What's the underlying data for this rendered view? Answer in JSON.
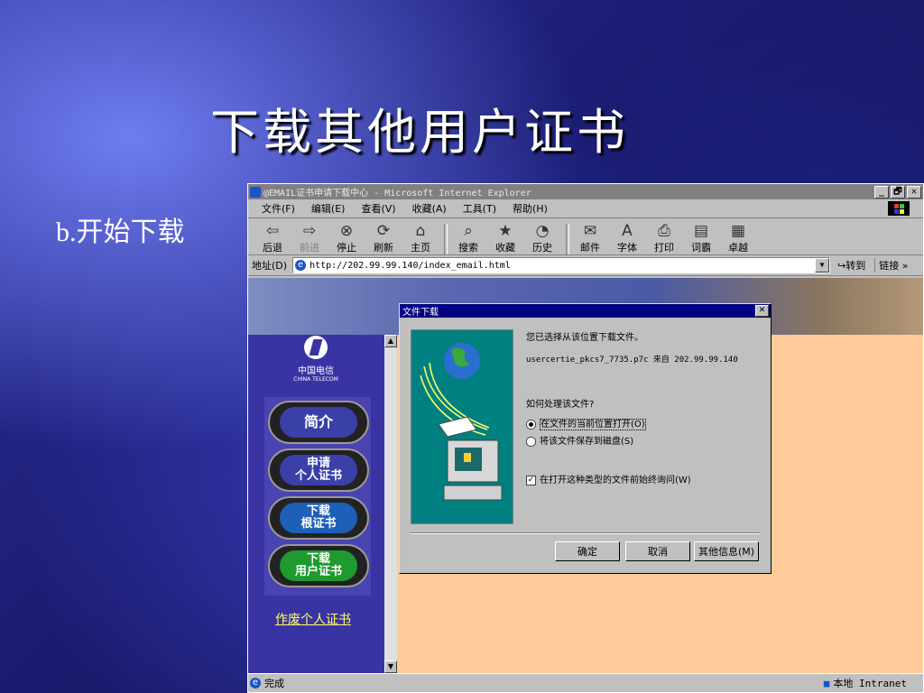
{
  "slide": {
    "title": "下载其他用户证书",
    "bullet": "b.开始下载"
  },
  "window": {
    "title": "@EMAIL证书申请下载中心 - Microsoft Internet Explorer",
    "controls": {
      "minimize": "_",
      "maximize": "🗗",
      "close": "✕"
    }
  },
  "menu": {
    "items": [
      "文件(F)",
      "编辑(E)",
      "查看(V)",
      "收藏(A)",
      "工具(T)",
      "帮助(H)"
    ]
  },
  "toolbar": {
    "buttons": [
      {
        "label": "后退",
        "icon": "back-icon",
        "glyph": "⇦"
      },
      {
        "label": "前进",
        "icon": "forward-icon",
        "glyph": "⇨"
      },
      {
        "label": "停止",
        "icon": "stop-icon",
        "glyph": "⊗"
      },
      {
        "label": "刷新",
        "icon": "refresh-icon",
        "glyph": "⟳"
      },
      {
        "label": "主页",
        "icon": "home-icon",
        "glyph": "⌂"
      },
      {
        "label": "搜索",
        "icon": "search-icon",
        "glyph": "⌕"
      },
      {
        "label": "收藏",
        "icon": "favorites-icon",
        "glyph": "★"
      },
      {
        "label": "历史",
        "icon": "history-icon",
        "glyph": "◔"
      },
      {
        "label": "邮件",
        "icon": "mail-icon",
        "glyph": "✉"
      },
      {
        "label": "字体",
        "icon": "font-icon",
        "glyph": "A"
      },
      {
        "label": "打印",
        "icon": "print-icon",
        "glyph": "⎙"
      },
      {
        "label": "词霸",
        "icon": "dictionary-icon",
        "glyph": "▤"
      },
      {
        "label": "卓越",
        "icon": "joyo-icon",
        "glyph": "▦"
      }
    ]
  },
  "address": {
    "label": "地址(D)",
    "url": "http://202.99.99.140/index_email.html",
    "go": "转到",
    "links": "链接 »"
  },
  "sidebar": {
    "logo_cn": "中国电信",
    "logo_en": "CHINA TELECOM",
    "nav": [
      {
        "label": "简介",
        "color": "#3b3fa8"
      },
      {
        "label": "申请\n个人证书",
        "color": "#3b3fa8"
      },
      {
        "label": "下载\n根证书",
        "color": "#1e5fb8"
      },
      {
        "label": "下载\n用户证书",
        "color": "#1e9a2e"
      }
    ],
    "revoke_link": "作废个人证书"
  },
  "status": {
    "text": "完成",
    "zone": "本地 Intranet"
  },
  "dialog": {
    "title": "文件下载",
    "close": "✕",
    "intro": "您已选择从该位置下载文件。",
    "file_line": "usercertie_pkcs7_7735.p7c 来自 202.99.99.140",
    "question": "如何处理该文件?",
    "option_open": "在文件的当前位置打开(O)",
    "option_save": "将该文件保存到磁盘(S)",
    "always_ask": "在打开这种类型的文件前始终询问(W)",
    "ok": "确定",
    "cancel": "取消",
    "more_info": "其他信息(M)"
  }
}
